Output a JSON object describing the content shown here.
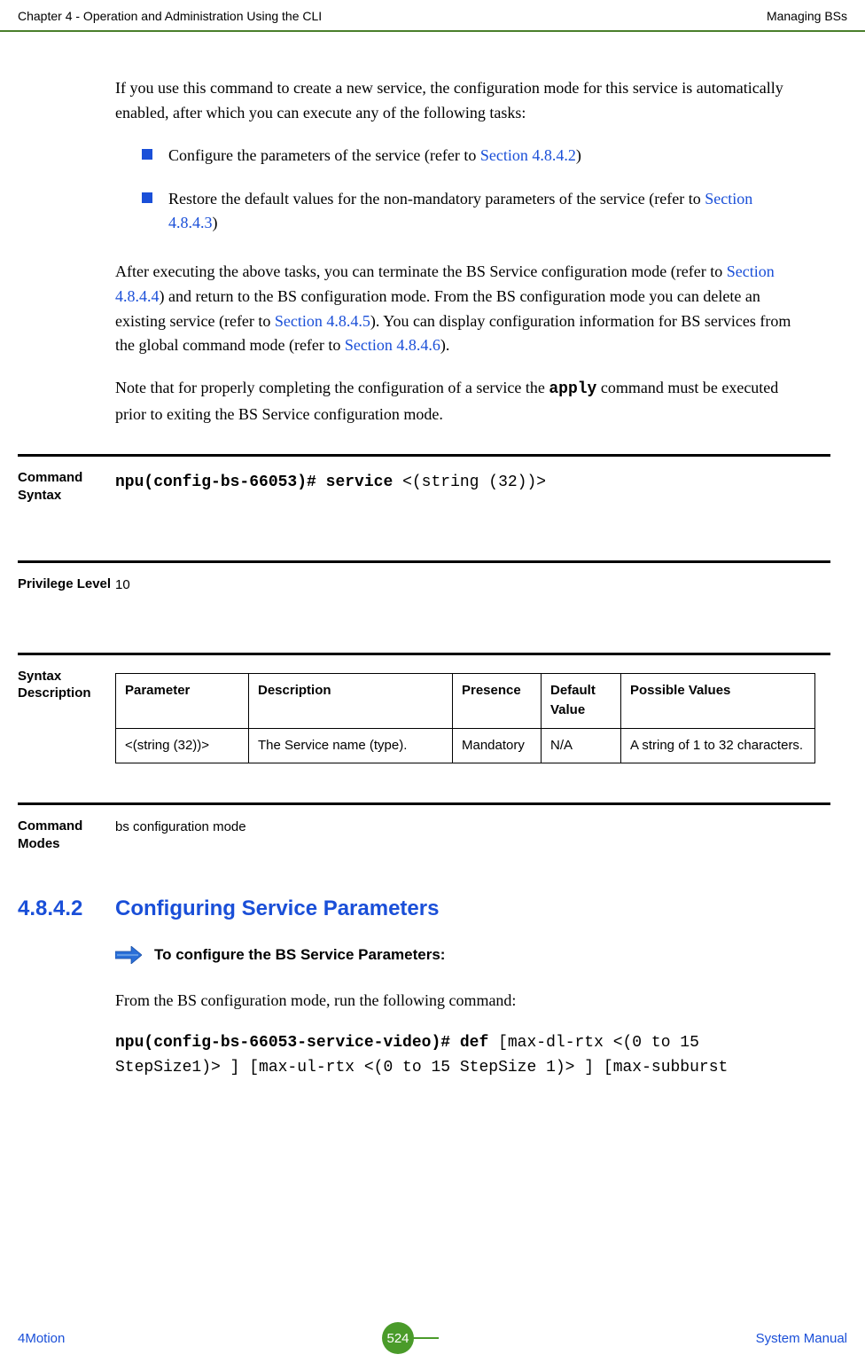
{
  "header": {
    "left": "Chapter 4 - Operation and Administration Using the CLI",
    "right": "Managing BSs"
  },
  "intro_para": "If you use this command to create a new service, the configuration mode for this service is automatically enabled, after which you can execute any of the following tasks:",
  "bullet1_prefix": "Configure the parameters of the service (refer to ",
  "bullet1_link": "Section 4.8.4.2",
  "bullet1_suffix": ")",
  "bullet2_prefix": "Restore the default values for the non-mandatory parameters of the service (refer to ",
  "bullet2_link": "Section 4.8.4.3",
  "bullet2_suffix": ")",
  "after_para_1a": "After executing the above tasks, you can terminate the BS Service configuration mode (refer to ",
  "after_para_1_link1": "Section 4.8.4.4",
  "after_para_1b": ") and return to the BS configuration mode. From the BS configuration mode you can delete an existing service (refer to ",
  "after_para_1_link2": "Section 4.8.4.5",
  "after_para_1c": "). You can display configuration information for BS services from the global command mode (refer to ",
  "after_para_1_link3": "Section 4.8.4.6",
  "after_para_1d": ").",
  "note_para_a": "Note that for properly completing the configuration of a service the ",
  "note_para_cmd": "apply",
  "note_para_b": " command must be executed prior to exiting the BS Service configuration mode.",
  "labels": {
    "command_syntax": "Command Syntax",
    "privilege_level": "Privilege Level",
    "syntax_description": "Syntax Description",
    "command_modes": "Command Modes"
  },
  "command_syntax_bold": "npu(config-bs-66053)# service ",
  "command_syntax_rest": "<(string (32))>",
  "privilege_level_value": "10",
  "table": {
    "headers": {
      "parameter": "Parameter",
      "description": "Description",
      "presence": "Presence",
      "default_value": "Default Value",
      "possible_values": "Possible Values"
    },
    "row": {
      "parameter": "<(string (32))>",
      "description": "The Service name (type).",
      "presence": "Mandatory",
      "default_value": "N/A",
      "possible_values": "A string of 1 to 32 characters."
    }
  },
  "command_modes_value": "bs configuration mode",
  "section": {
    "number": "4.8.4.2",
    "title": "Configuring Service Parameters"
  },
  "procedure_heading": "To configure the BS Service Parameters:",
  "proc_para": "From the BS configuration mode, run the following command:",
  "code_bold1": "npu(config-bs-66053-service-video)# def ",
  "code_rest": "[max-dl-rtx <(0 to 15 StepSize1)> ] [max-ul-rtx <(0 to 15 StepSize 1)> ] [max-subburst",
  "footer": {
    "left": "4Motion",
    "page": "524",
    "right": "System Manual"
  }
}
